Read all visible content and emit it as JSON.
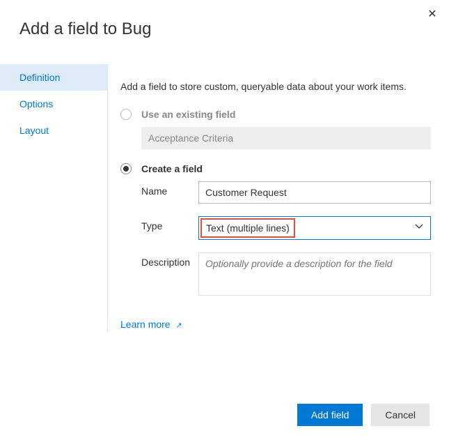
{
  "title": "Add a field to Bug",
  "sidebar": {
    "tabs": [
      {
        "label": "Definition"
      },
      {
        "label": "Options"
      },
      {
        "label": "Layout"
      }
    ]
  },
  "main": {
    "intro": "Add a field to store custom, queryable data about your work items.",
    "existing": {
      "label": "Use an existing field",
      "value": "Acceptance Criteria"
    },
    "create": {
      "label": "Create a field",
      "name_label": "Name",
      "name_value": "Customer Request",
      "type_label": "Type",
      "type_value": "Text (multiple lines)",
      "desc_label": "Description",
      "desc_placeholder": "Optionally provide a description for the field"
    },
    "learn_more": "Learn more"
  },
  "footer": {
    "primary": "Add field",
    "secondary": "Cancel"
  }
}
